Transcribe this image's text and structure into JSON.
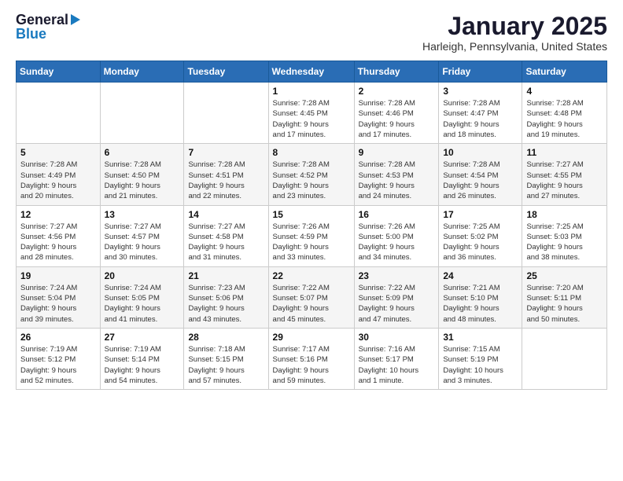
{
  "header": {
    "logo_general": "General",
    "logo_blue": "Blue",
    "month": "January 2025",
    "location": "Harleigh, Pennsylvania, United States"
  },
  "weekdays": [
    "Sunday",
    "Monday",
    "Tuesday",
    "Wednesday",
    "Thursday",
    "Friday",
    "Saturday"
  ],
  "weeks": [
    [
      {
        "day": "",
        "info": ""
      },
      {
        "day": "",
        "info": ""
      },
      {
        "day": "",
        "info": ""
      },
      {
        "day": "1",
        "info": "Sunrise: 7:28 AM\nSunset: 4:45 PM\nDaylight: 9 hours\nand 17 minutes."
      },
      {
        "day": "2",
        "info": "Sunrise: 7:28 AM\nSunset: 4:46 PM\nDaylight: 9 hours\nand 17 minutes."
      },
      {
        "day": "3",
        "info": "Sunrise: 7:28 AM\nSunset: 4:47 PM\nDaylight: 9 hours\nand 18 minutes."
      },
      {
        "day": "4",
        "info": "Sunrise: 7:28 AM\nSunset: 4:48 PM\nDaylight: 9 hours\nand 19 minutes."
      }
    ],
    [
      {
        "day": "5",
        "info": "Sunrise: 7:28 AM\nSunset: 4:49 PM\nDaylight: 9 hours\nand 20 minutes."
      },
      {
        "day": "6",
        "info": "Sunrise: 7:28 AM\nSunset: 4:50 PM\nDaylight: 9 hours\nand 21 minutes."
      },
      {
        "day": "7",
        "info": "Sunrise: 7:28 AM\nSunset: 4:51 PM\nDaylight: 9 hours\nand 22 minutes."
      },
      {
        "day": "8",
        "info": "Sunrise: 7:28 AM\nSunset: 4:52 PM\nDaylight: 9 hours\nand 23 minutes."
      },
      {
        "day": "9",
        "info": "Sunrise: 7:28 AM\nSunset: 4:53 PM\nDaylight: 9 hours\nand 24 minutes."
      },
      {
        "day": "10",
        "info": "Sunrise: 7:28 AM\nSunset: 4:54 PM\nDaylight: 9 hours\nand 26 minutes."
      },
      {
        "day": "11",
        "info": "Sunrise: 7:27 AM\nSunset: 4:55 PM\nDaylight: 9 hours\nand 27 minutes."
      }
    ],
    [
      {
        "day": "12",
        "info": "Sunrise: 7:27 AM\nSunset: 4:56 PM\nDaylight: 9 hours\nand 28 minutes."
      },
      {
        "day": "13",
        "info": "Sunrise: 7:27 AM\nSunset: 4:57 PM\nDaylight: 9 hours\nand 30 minutes."
      },
      {
        "day": "14",
        "info": "Sunrise: 7:27 AM\nSunset: 4:58 PM\nDaylight: 9 hours\nand 31 minutes."
      },
      {
        "day": "15",
        "info": "Sunrise: 7:26 AM\nSunset: 4:59 PM\nDaylight: 9 hours\nand 33 minutes."
      },
      {
        "day": "16",
        "info": "Sunrise: 7:26 AM\nSunset: 5:00 PM\nDaylight: 9 hours\nand 34 minutes."
      },
      {
        "day": "17",
        "info": "Sunrise: 7:25 AM\nSunset: 5:02 PM\nDaylight: 9 hours\nand 36 minutes."
      },
      {
        "day": "18",
        "info": "Sunrise: 7:25 AM\nSunset: 5:03 PM\nDaylight: 9 hours\nand 38 minutes."
      }
    ],
    [
      {
        "day": "19",
        "info": "Sunrise: 7:24 AM\nSunset: 5:04 PM\nDaylight: 9 hours\nand 39 minutes."
      },
      {
        "day": "20",
        "info": "Sunrise: 7:24 AM\nSunset: 5:05 PM\nDaylight: 9 hours\nand 41 minutes."
      },
      {
        "day": "21",
        "info": "Sunrise: 7:23 AM\nSunset: 5:06 PM\nDaylight: 9 hours\nand 43 minutes."
      },
      {
        "day": "22",
        "info": "Sunrise: 7:22 AM\nSunset: 5:07 PM\nDaylight: 9 hours\nand 45 minutes."
      },
      {
        "day": "23",
        "info": "Sunrise: 7:22 AM\nSunset: 5:09 PM\nDaylight: 9 hours\nand 47 minutes."
      },
      {
        "day": "24",
        "info": "Sunrise: 7:21 AM\nSunset: 5:10 PM\nDaylight: 9 hours\nand 48 minutes."
      },
      {
        "day": "25",
        "info": "Sunrise: 7:20 AM\nSunset: 5:11 PM\nDaylight: 9 hours\nand 50 minutes."
      }
    ],
    [
      {
        "day": "26",
        "info": "Sunrise: 7:19 AM\nSunset: 5:12 PM\nDaylight: 9 hours\nand 52 minutes."
      },
      {
        "day": "27",
        "info": "Sunrise: 7:19 AM\nSunset: 5:14 PM\nDaylight: 9 hours\nand 54 minutes."
      },
      {
        "day": "28",
        "info": "Sunrise: 7:18 AM\nSunset: 5:15 PM\nDaylight: 9 hours\nand 57 minutes."
      },
      {
        "day": "29",
        "info": "Sunrise: 7:17 AM\nSunset: 5:16 PM\nDaylight: 9 hours\nand 59 minutes."
      },
      {
        "day": "30",
        "info": "Sunrise: 7:16 AM\nSunset: 5:17 PM\nDaylight: 10 hours\nand 1 minute."
      },
      {
        "day": "31",
        "info": "Sunrise: 7:15 AM\nSunset: 5:19 PM\nDaylight: 10 hours\nand 3 minutes."
      },
      {
        "day": "",
        "info": ""
      }
    ]
  ]
}
